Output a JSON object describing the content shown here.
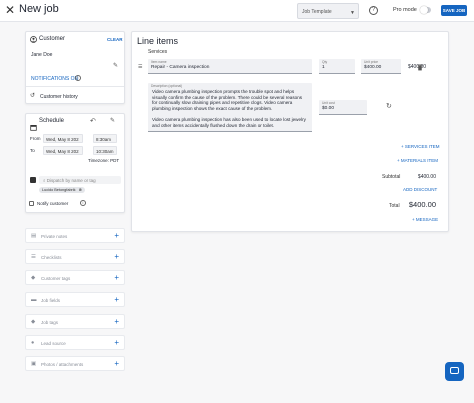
{
  "header": {
    "close_glyph": "✕",
    "title": "New job",
    "template_select": "Job Template",
    "pro_mode_label": "Pro mode",
    "save_label": "SAVE JOB"
  },
  "customer": {
    "title": "Customer",
    "clear_label": "CLEAR",
    "name": "Jane Doe",
    "notifications_label": "NOTIFICATIONS ON",
    "history_label": "Customer history"
  },
  "schedule": {
    "title": "Schedule",
    "from_label": "From",
    "to_label": "To",
    "from_date": "Wed, May 8 202",
    "from_time": "8:30am",
    "to_date": "Wed, May 8 202",
    "to_time": "10:30am",
    "timezone": "Timezone: PDT",
    "dispatch_placeholder": "Dispatch by name or tag",
    "assignee_chip": "Lucido Betongfabrik",
    "notify_label": "Notify customer"
  },
  "sections": [
    {
      "label": "Private notes",
      "icon": "note-icon"
    },
    {
      "label": "Checklists",
      "icon": "checklist-icon"
    },
    {
      "label": "Customer tags",
      "icon": "tag-icon"
    },
    {
      "label": "Job fields",
      "icon": "folder-icon"
    },
    {
      "label": "Job tags",
      "icon": "tag-icon"
    },
    {
      "label": "Lead source",
      "icon": "person-icon"
    },
    {
      "label": "Photos / attachments",
      "icon": "photo-icon"
    }
  ],
  "line_items": {
    "title": "Line items",
    "services_label": "Services",
    "item_name_label": "Item name",
    "item_name": "Repair - Camera inspection",
    "qty_label": "Qty",
    "qty": "1",
    "unit_price_label": "Unit price",
    "unit_price": "$400.00",
    "line_total": "$400.00",
    "description_label": "Description (optional)",
    "description": "Video camera plumbing inspection prompts the trouble spot and helps visually confirm the cause of the problem. There could be several reasons for continually slow draining pipes and repetitive clogs. Video camera plumbing inspection shows the exact cause of the problem.\n\nVideo camera plumbing inspection has also been used to locate lost jewelry and other items accidentally flushed down the drain or toilet.",
    "unit_cost_label": "Unit cost",
    "unit_cost": "$0.00",
    "add_service": "+ SERVICES ITEM",
    "add_material": "+ MATERIALS ITEM",
    "subtotal_label": "Subtotal",
    "subtotal": "$400.00",
    "add_discount": "ADD DISCOUNT",
    "total_label": "Total",
    "total": "$400.00",
    "add_message": "+ MESSAGE"
  }
}
